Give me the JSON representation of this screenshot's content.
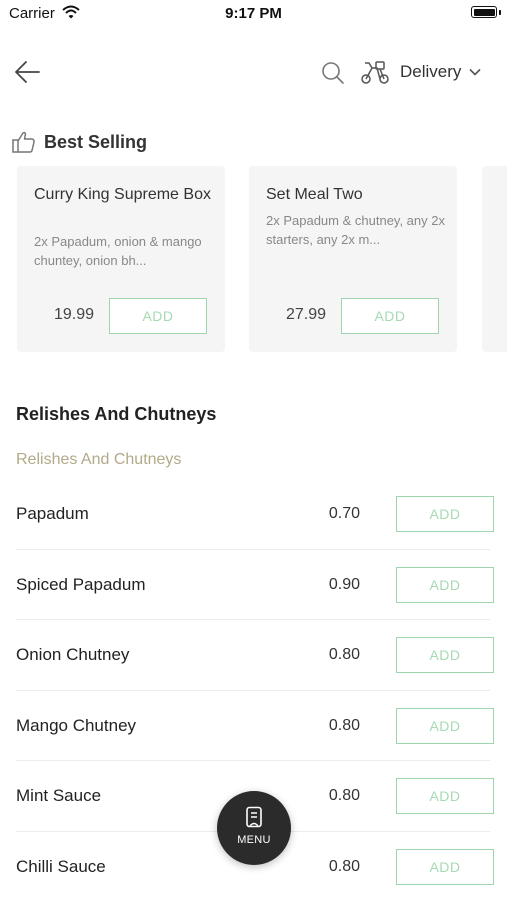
{
  "status_bar": {
    "carrier": "Carrier",
    "time": "9:17 PM"
  },
  "nav": {
    "back_icon": "arrow-left-icon",
    "search_icon": "search-icon",
    "delivery_icon": "scooter-icon",
    "delivery_label": "Delivery",
    "dropdown_icon": "chevron-down-icon"
  },
  "best_selling": {
    "title": "Best Selling",
    "icon": "thumbs-up-icon",
    "items": [
      {
        "name": "Curry King Supreme Box",
        "desc": "2x Papadum, onion & mango chuntey, onion bh...",
        "price": "19.99",
        "add_label": "ADD"
      },
      {
        "name": "Set Meal Two",
        "desc": "2x Papadum & chutney, any 2x starters, any 2x m...",
        "price": "27.99",
        "add_label": "ADD"
      }
    ]
  },
  "section": {
    "title": "Relishes And Chutneys",
    "subtitle": "Relishes And Chutneys",
    "items": [
      {
        "name": "Papadum",
        "price": "0.70",
        "add_label": "ADD"
      },
      {
        "name": "Spiced Papadum",
        "price": "0.90",
        "add_label": "ADD"
      },
      {
        "name": "Onion Chutney",
        "price": "0.80",
        "add_label": "ADD"
      },
      {
        "name": "Mango Chutney",
        "price": "0.80",
        "add_label": "ADD"
      },
      {
        "name": "Mint Sauce",
        "price": "0.80",
        "add_label": "ADD"
      },
      {
        "name": "Chilli Sauce",
        "price": "0.80",
        "add_label": "ADD"
      }
    ]
  },
  "fab": {
    "label": "MENU",
    "icon": "menu-book-icon"
  },
  "colors": {
    "accent_green": "#9fd5ad",
    "muted_gold": "#b3a989",
    "card_bg": "#f5f5f5",
    "fab_bg": "#2b2b2b"
  }
}
